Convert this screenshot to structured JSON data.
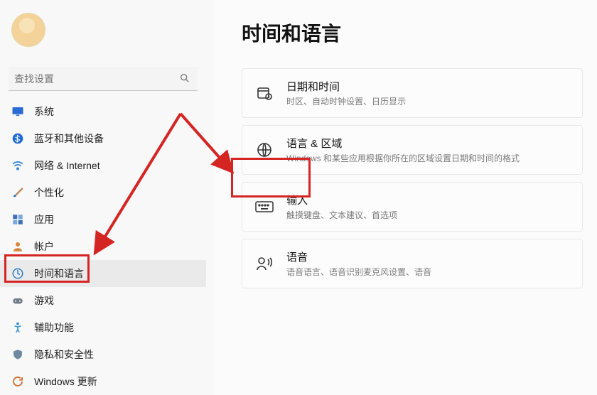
{
  "search": {
    "placeholder": "查找设置"
  },
  "sidebar": {
    "items": [
      {
        "label": "系统"
      },
      {
        "label": "蓝牙和其他设备"
      },
      {
        "label": "网络 & Internet"
      },
      {
        "label": "个性化"
      },
      {
        "label": "应用"
      },
      {
        "label": "帐户"
      },
      {
        "label": "时间和语言"
      },
      {
        "label": "游戏"
      },
      {
        "label": "辅助功能"
      },
      {
        "label": "隐私和安全性"
      },
      {
        "label": "Windows 更新"
      }
    ]
  },
  "page": {
    "title": "时间和语言"
  },
  "cards": [
    {
      "title": "日期和时间",
      "desc": "时区、自动时钟设置、日历显示"
    },
    {
      "title": "语言 & 区域",
      "desc": "Windows 和某些应用根据你所在的区域设置日期和时间的格式"
    },
    {
      "title": "输入",
      "desc": "触摸键盘、文本建议、首选项"
    },
    {
      "title": "语音",
      "desc": "语音语言、语音识别麦克风设置、语音"
    }
  ]
}
